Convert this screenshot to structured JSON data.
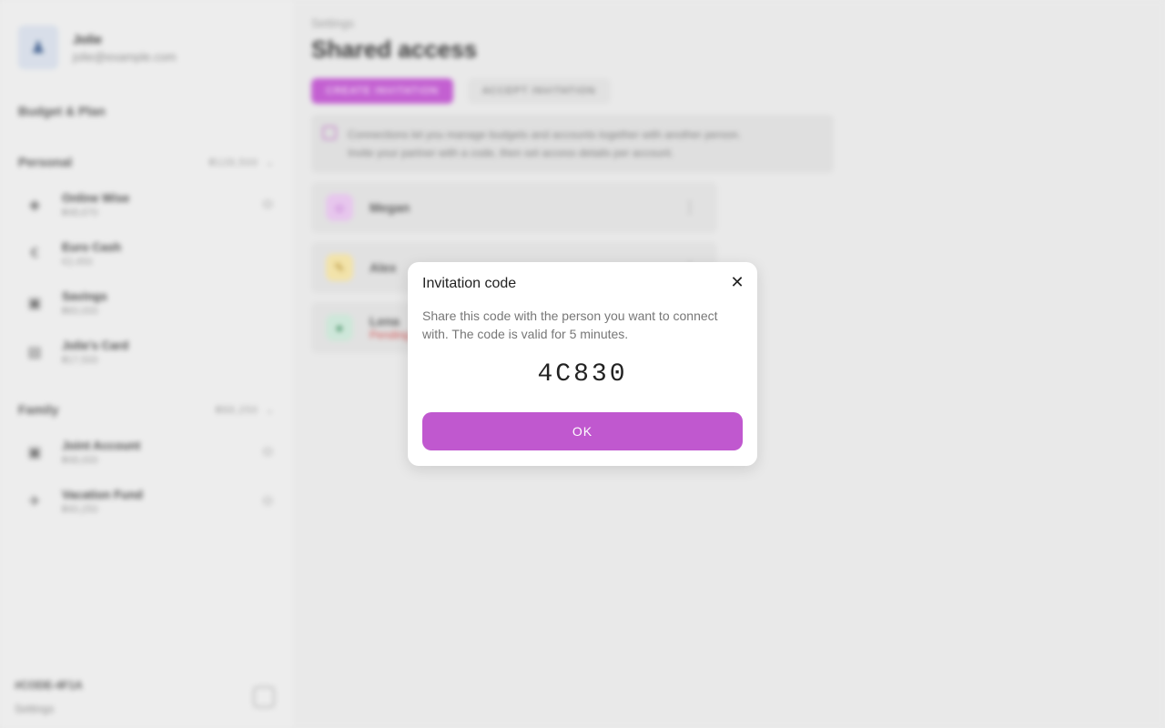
{
  "sidebar": {
    "user_name": "Jolie",
    "user_email": "jolie@example.com",
    "budget_title": "Budget & Plan",
    "sections": [
      {
        "name": "Personal",
        "total": "₴128,500",
        "accounts": [
          {
            "name": "Online Wise",
            "balance": "₴48,670",
            "icon": "wallet-icon"
          },
          {
            "name": "Euro Cash",
            "balance": "€2,450",
            "icon": "euro-icon"
          },
          {
            "name": "Savings",
            "balance": "₴60,000",
            "icon": "bank-icon"
          },
          {
            "name": "Jolie's Card",
            "balance": "₴17,500",
            "icon": "card-icon"
          }
        ]
      },
      {
        "name": "Family",
        "total": "₴88,250",
        "accounts": [
          {
            "name": "Joint Account",
            "balance": "₴48,000",
            "icon": "bank-icon"
          },
          {
            "name": "Vacation Fund",
            "balance": "₴40,250",
            "icon": "plane-icon"
          }
        ]
      }
    ],
    "footer_code": "#CODE-4F1A",
    "footer_settings": "Settings"
  },
  "main": {
    "breadcrumb": "Settings",
    "title": "Shared access",
    "tabs": {
      "create": "CREATE INVITATION",
      "accept": "ACCEPT INVITATION"
    },
    "info_line1": "Connections let you manage budgets and accounts together with another person.",
    "info_line2": "Invite your partner with a code, then set access details per account.",
    "connections": [
      {
        "name": "Megan",
        "sub": "",
        "icon_bg": "#e6c4ec",
        "icon_color": "#b04ac6",
        "glyph": "☺"
      },
      {
        "name": "Alex",
        "sub": "",
        "icon_bg": "#f2e2a6",
        "icon_color": "#a8801c",
        "glyph": "✎"
      },
      {
        "name": "Lena",
        "sub": "Pending",
        "icon_bg": "#cce6d8",
        "icon_color": "#3a8a5c",
        "glyph": "●"
      }
    ]
  },
  "dialog": {
    "title": "Invitation code",
    "description": "Share this code with the person you want to connect with. The code is valid for 5 minutes.",
    "code": "4C830",
    "ok_label": "OK",
    "close_glyph": "✕"
  },
  "colors": {
    "accent": "#c058cf"
  }
}
